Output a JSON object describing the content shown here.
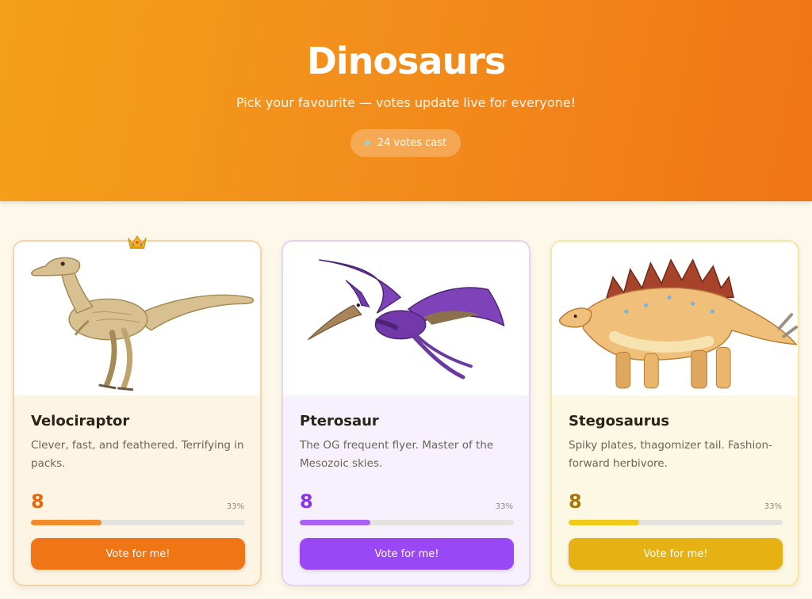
{
  "header": {
    "title": "Dinosaurs",
    "subtitle": "Pick your favourite — votes update live for everyone!",
    "votes_label": "24 votes cast",
    "colors": {
      "gradient_start": "#f4a01a",
      "gradient_end": "#f07514"
    }
  },
  "leader_icon": "crown-icon",
  "cards": [
    {
      "name": "Velociraptor",
      "description": "Clever, fast, and feathered. Terrifying in packs.",
      "votes": "8",
      "percent_label": "33%",
      "share": 0.33,
      "button_label": "Vote for me!",
      "accent": "#f07514"
    },
    {
      "name": "Pterosaur",
      "description": "The OG frequent flyer. Master of the Mesozoic skies.",
      "votes": "8",
      "percent_label": "33%",
      "share": 0.33,
      "button_label": "Vote for me!",
      "accent": "#9a48f5"
    },
    {
      "name": "Stegosaurus",
      "description": "Spiky plates, thagomizer tail. Fashion-forward herbivore.",
      "votes": "8",
      "percent_label": "33%",
      "share": 0.33,
      "button_label": "Vote for me!",
      "accent": "#e6b213"
    }
  ]
}
